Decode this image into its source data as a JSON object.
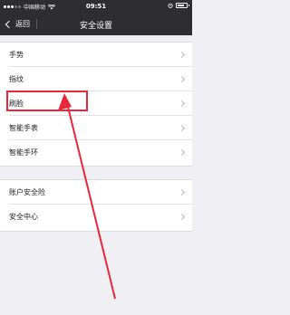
{
  "status_bar": {
    "carrier": "中国移动",
    "time": "09:51",
    "network_icon": "wifi-icon",
    "battery_level": 0.8
  },
  "nav_bar": {
    "back_label": "返回",
    "title": "安全设置"
  },
  "groups": [
    {
      "items": [
        {
          "label": "手势"
        },
        {
          "label": "指纹"
        },
        {
          "label": "刷脸"
        },
        {
          "label": "智能手表"
        },
        {
          "label": "智能手环"
        }
      ]
    },
    {
      "items": [
        {
          "label": "账户安全险"
        },
        {
          "label": "安全中心"
        }
      ]
    }
  ],
  "annotation": {
    "highlighted_item": "刷脸",
    "highlight_color": "#e8283a",
    "arrow_color": "#e8283a"
  }
}
